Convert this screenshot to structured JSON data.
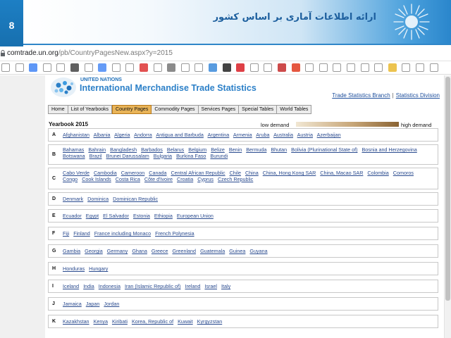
{
  "slide": {
    "number": "8",
    "title": "ارائه اطلاعات آماری بر اساس کشور",
    "accent": "#1d7fc4"
  },
  "browser": {
    "url_host": "comtrade.un.org",
    "url_path": "/pb/CountryPagesNew.aspx?y=2015",
    "bookmark_icons": [
      "page-icon",
      "page-icon",
      "google-icon",
      "book-icon",
      "page-icon",
      "wiki-icon",
      "page-icon",
      "translate-icon",
      "page-icon",
      "page-icon",
      "flag-icon",
      "page-icon",
      "gauge-icon",
      "page-icon",
      "page-icon",
      "m-icon",
      "b-icon",
      "red-square-icon",
      "page-icon",
      "page-icon",
      "pause-icon",
      "t-icon",
      "page-icon",
      "page-icon",
      "page-icon",
      "page-icon",
      "page-icon",
      "page-icon",
      "folder-icon",
      "page-icon",
      "page-icon",
      "page-icon"
    ]
  },
  "un_page": {
    "org": "UNITED NATIONS",
    "title": "International Merchandise Trade Statistics",
    "links": [
      "Trade Statistics Branch",
      "Statistics Division"
    ],
    "link_separator": "|",
    "nav_tabs": [
      "Home",
      "List of Yearbooks",
      "Country Pages",
      "Commodity Pages",
      "Services Pages",
      "Special Tables",
      "World Tables"
    ],
    "active_tab": "Country Pages",
    "yearbook_label": "Yearbook 2015",
    "legend_low": "low demand",
    "legend_high": "high demand",
    "letters": [
      {
        "letter": "A",
        "countries": [
          "Afghanistan",
          "Albania",
          "Algeria",
          "Andorra",
          "Antigua and Barbuda",
          "Argentina",
          "Armenia",
          "Aruba",
          "Australia",
          "Austria",
          "Azerbaijan"
        ]
      },
      {
        "letter": "B",
        "countries": [
          "Bahamas",
          "Bahrain",
          "Bangladesh",
          "Barbados",
          "Belarus",
          "Belgium",
          "Belize",
          "Benin",
          "Bermuda",
          "Bhutan",
          "Bolivia (Plurinational State of)",
          "Bosnia and Herzegovina",
          "Botswana",
          "Brazil",
          "Brunei Darussalam",
          "Bulgaria",
          "Burkina Faso",
          "Burundi"
        ]
      },
      {
        "letter": "C",
        "countries": [
          "Cabo Verde",
          "Cambodia",
          "Cameroon",
          "Canada",
          "Central African Republic",
          "Chile",
          "China",
          "China, Hong Kong SAR",
          "China, Macao SAR",
          "Colombia",
          "Comoros",
          "Congo",
          "Cook Islands",
          "Costa Rica",
          "Côte d'Ivoire",
          "Croatia",
          "Cyprus",
          "Czech Republic"
        ]
      },
      {
        "letter": "D",
        "countries": [
          "Denmark",
          "Dominica",
          "Dominican Republic"
        ]
      },
      {
        "letter": "E",
        "countries": [
          "Ecuador",
          "Egypt",
          "El Salvador",
          "Estonia",
          "Ethiopia",
          "European Union"
        ]
      },
      {
        "letter": "F",
        "countries": [
          "Fiji",
          "Finland",
          "France including Monaco",
          "French Polynesia"
        ]
      },
      {
        "letter": "G",
        "countries": [
          "Gambia",
          "Georgia",
          "Germany",
          "Ghana",
          "Greece",
          "Greenland",
          "Guatemala",
          "Guinea",
          "Guyana"
        ]
      },
      {
        "letter": "H",
        "countries": [
          "Honduras",
          "Hungary"
        ]
      },
      {
        "letter": "I",
        "countries": [
          "Iceland",
          "India",
          "Indonesia",
          "Iran (Islamic Republic of)",
          "Ireland",
          "Israel",
          "Italy"
        ]
      },
      {
        "letter": "J",
        "countries": [
          "Jamaica",
          "Japan",
          "Jordan"
        ]
      },
      {
        "letter": "K",
        "countries": [
          "Kazakhstan",
          "Kenya",
          "Kiribati",
          "Korea, Republic of",
          "Kuwait",
          "Kyrgyzstan"
        ]
      }
    ]
  }
}
